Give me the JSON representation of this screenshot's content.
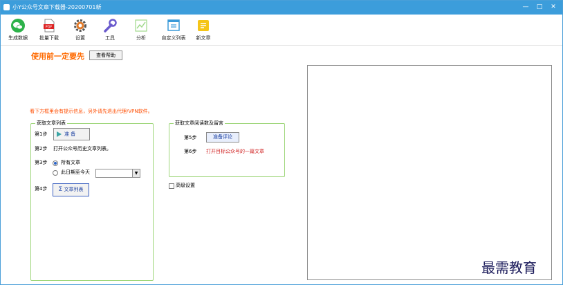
{
  "window": {
    "title": "小Y公众号文章下载器-20200701新",
    "controls": {
      "minimize": "—",
      "maximize": "□",
      "close": "✕"
    }
  },
  "toolbar": {
    "items": [
      {
        "label": "生成数据",
        "icon": "wechat-icon"
      },
      {
        "label": "批量下载",
        "icon": "pdf-icon"
      },
      {
        "label": "设置",
        "icon": "gear-icon"
      },
      {
        "label": "工具",
        "icon": "wrench-icon"
      },
      {
        "label": "分析",
        "icon": "chart-icon"
      },
      {
        "label": "自定义列表",
        "icon": "list-window-icon"
      },
      {
        "label": "新文章",
        "icon": "new-article-icon"
      }
    ]
  },
  "main": {
    "tip": "使用前一定要先",
    "help_button": "查看帮助",
    "notice": "看下方框里会有提示信息，另外请先退出代理/VPN软件。"
  },
  "article_list_group": {
    "title": "获取文章列表",
    "step1": {
      "label": "第1步",
      "button": "准 备"
    },
    "step2": {
      "label": "第2步",
      "text": "打开公众号历史文章列表。"
    },
    "step3": {
      "label": "第3步",
      "option_all": "所有文章",
      "option_date": "此日期至今天",
      "date_value": ""
    },
    "step4": {
      "label": "第4步",
      "button": "文章列表"
    }
  },
  "reads_group": {
    "title": "获取文章阅读数及留言",
    "step5": {
      "label": "第5步",
      "button": "准备评论"
    },
    "step6": {
      "label": "第6步",
      "text": "打开目标公众号的一篇文章"
    }
  },
  "advanced": {
    "label": "高级设置",
    "checked": false
  },
  "watermark": "最需教育"
}
